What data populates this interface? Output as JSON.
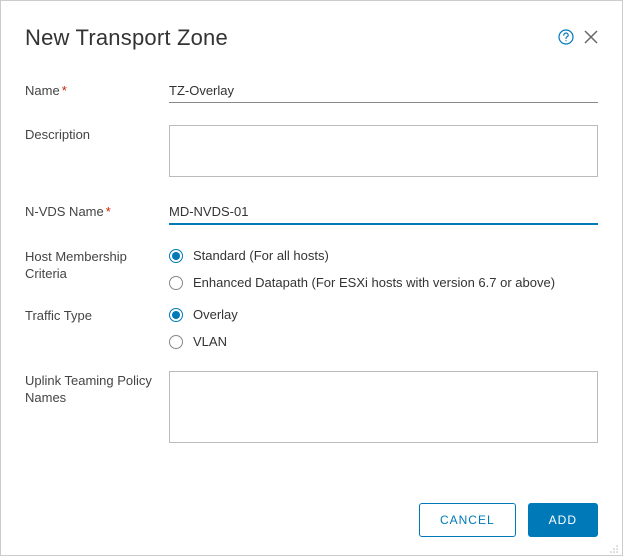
{
  "dialog": {
    "title": "New Transport Zone"
  },
  "fields": {
    "name": {
      "label": "Name",
      "value": "TZ-Overlay"
    },
    "description": {
      "label": "Description",
      "value": ""
    },
    "nvds_name": {
      "label": "N-VDS Name",
      "value": "MD-NVDS-01"
    },
    "host_membership": {
      "label": "Host Membership Criteria",
      "options": {
        "standard": "Standard (For all hosts)",
        "enhanced": "Enhanced Datapath (For ESXi hosts with version 6.7 or above)"
      },
      "selected": "standard"
    },
    "traffic_type": {
      "label": "Traffic Type",
      "options": {
        "overlay": "Overlay",
        "vlan": "VLAN"
      },
      "selected": "overlay"
    },
    "uplink_teaming": {
      "label": "Uplink Teaming Policy Names",
      "value": ""
    }
  },
  "buttons": {
    "cancel": "CANCEL",
    "add": "ADD"
  }
}
